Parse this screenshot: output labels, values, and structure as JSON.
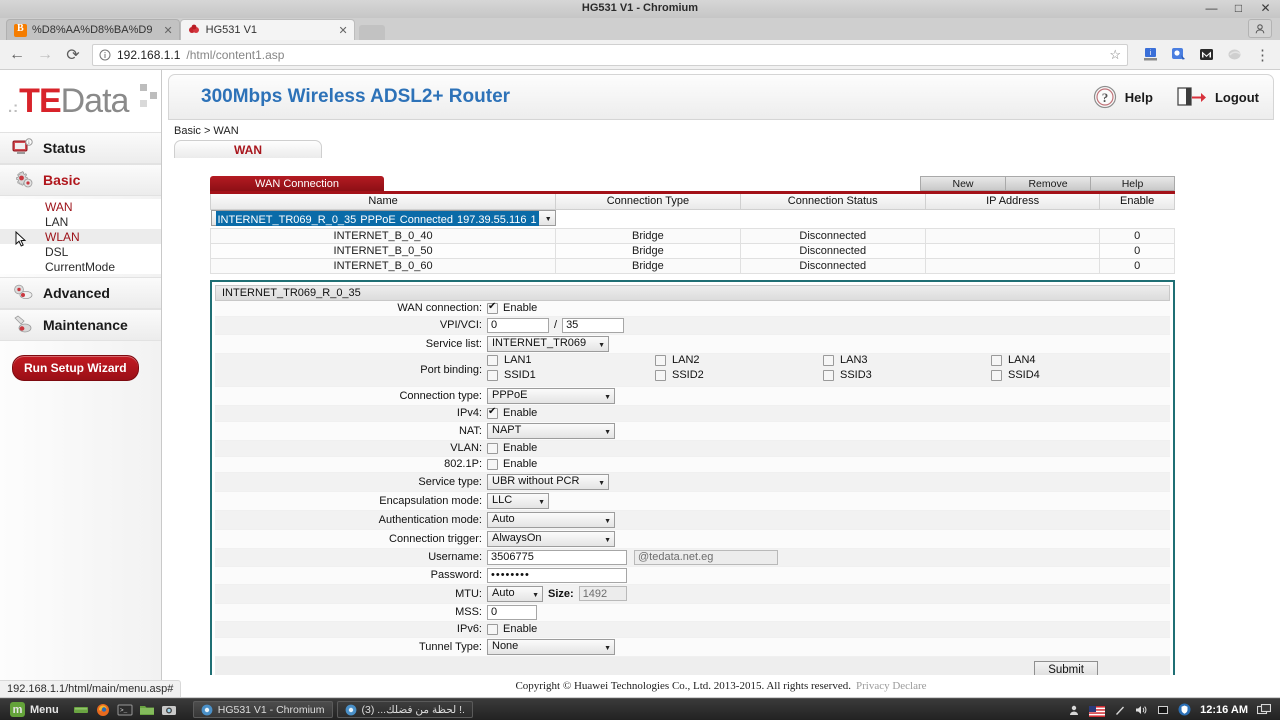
{
  "browser": {
    "window_title": "HG531 V1 - Chromium",
    "minimize": "—",
    "maximize": "□",
    "close": "✕",
    "tabs": [
      {
        "title": "%D8%AA%D8%BA%D9",
        "favicon": "blogger-icon",
        "active": false,
        "close": "✕"
      },
      {
        "title": "HG531 V1",
        "favicon": "router-icon",
        "active": true,
        "close": "✕"
      }
    ],
    "nav": {
      "back": "←",
      "forward": "→",
      "reload": "⟳"
    },
    "address": {
      "security_icon": "info-circle-icon",
      "host": "192.168.1.1",
      "path": "/html/content1.asp",
      "star": "☆"
    },
    "extensions": [
      "extension-icon-1",
      "extension-icon-2",
      "gmail-icon",
      "extension-icon-4"
    ],
    "menu": "⋮"
  },
  "sidebar": {
    "logo": {
      "te": "TE",
      "data": "Data"
    },
    "groups": [
      {
        "label": "Status",
        "icon": "status-monitor-icon",
        "active": false
      },
      {
        "label": "Basic",
        "icon": "gear-icon",
        "active": true
      },
      {
        "label": "Advanced",
        "icon": "advanced-gears-icon",
        "active": false
      },
      {
        "label": "Maintenance",
        "icon": "wrench-icon",
        "active": false
      }
    ],
    "basic_items": [
      {
        "label": "WAN",
        "selected": true,
        "hover": false
      },
      {
        "label": "LAN",
        "selected": false,
        "hover": false
      },
      {
        "label": "WLAN",
        "selected": true,
        "hover": true
      },
      {
        "label": "DSL",
        "selected": false,
        "hover": false
      },
      {
        "label": "CurrentMode",
        "selected": false,
        "hover": false
      }
    ],
    "wizard_button": "Run Setup Wizard"
  },
  "header": {
    "title": "300Mbps Wireless ADSL2+ Router",
    "help": "Help",
    "help_icon": "question-mark-icon",
    "logout": "Logout",
    "logout_icon": "logout-door-icon",
    "breadcrumb": "Basic > WAN",
    "page_tab": "WAN"
  },
  "wan_table": {
    "section_title": "WAN Connection",
    "buttons": {
      "new": "New",
      "remove": "Remove",
      "help": "Help"
    },
    "columns": [
      "Name",
      "Connection Type",
      "Connection Status",
      "IP Address",
      "Enable"
    ],
    "rows": [
      {
        "name": "INTERNET_TR069_R_0_35",
        "type": "PPPoE",
        "status": "Connected",
        "ip": "197.39.55.116",
        "enable": "1",
        "selected": true
      },
      {
        "name": "INTERNET_B_0_40",
        "type": "Bridge",
        "status": "Disconnected",
        "ip": "",
        "enable": "0",
        "selected": false
      },
      {
        "name": "INTERNET_B_0_50",
        "type": "Bridge",
        "status": "Disconnected",
        "ip": "",
        "enable": "0",
        "selected": false
      },
      {
        "name": "INTERNET_B_0_60",
        "type": "Bridge",
        "status": "Disconnected",
        "ip": "",
        "enable": "0",
        "selected": false
      }
    ]
  },
  "form": {
    "title": "INTERNET_TR069_R_0_35",
    "wan_connection": {
      "label": "WAN connection:",
      "checkbox_label": "Enable",
      "checked": true
    },
    "vpi_vci": {
      "label": "VPI/VCI:",
      "vpi": "0",
      "separator": "/",
      "vci": "35"
    },
    "service_list": {
      "label": "Service list:",
      "value": "INTERNET_TR069"
    },
    "port_binding": {
      "label": "Port binding:",
      "items": [
        {
          "label": "LAN1",
          "checked": false
        },
        {
          "label": "LAN2",
          "checked": false
        },
        {
          "label": "LAN3",
          "checked": false
        },
        {
          "label": "LAN4",
          "checked": false
        },
        {
          "label": "SSID1",
          "checked": false
        },
        {
          "label": "SSID2",
          "checked": false
        },
        {
          "label": "SSID3",
          "checked": false
        },
        {
          "label": "SSID4",
          "checked": false
        }
      ]
    },
    "connection_type": {
      "label": "Connection type:",
      "value": "PPPoE"
    },
    "ipv4": {
      "label": "IPv4:",
      "checkbox_label": "Enable",
      "checked": true
    },
    "nat": {
      "label": "NAT:",
      "value": "NAPT"
    },
    "vlan": {
      "label": "VLAN:",
      "checkbox_label": "Enable",
      "checked": false
    },
    "dot1p": {
      "label": "802.1P:",
      "checkbox_label": "Enable",
      "checked": false
    },
    "service_type": {
      "label": "Service type:",
      "value": "UBR without PCR"
    },
    "encapsulation_mode": {
      "label": "Encapsulation mode:",
      "value": "LLC"
    },
    "authentication_mode": {
      "label": "Authentication mode:",
      "value": "Auto"
    },
    "connection_trigger": {
      "label": "Connection trigger:",
      "value": "AlwaysOn"
    },
    "username": {
      "label": "Username:",
      "value": "3506775",
      "suffix": "@tedata.net.eg"
    },
    "password": {
      "label": "Password:",
      "value": "••••••••"
    },
    "mtu": {
      "label": "MTU:",
      "value": "Auto",
      "size_label": "Size:",
      "size_value": "1492"
    },
    "mss": {
      "label": "MSS:",
      "value": "0"
    },
    "ipv6": {
      "label": "IPv6:",
      "checkbox_label": "Enable",
      "checked": false
    },
    "tunnel_type": {
      "label": "Tunnel Type:",
      "value": "None"
    },
    "submit": "Submit"
  },
  "footer": {
    "copyright": "Copyright © Huawei Technologies Co., Ltd. 2013-2015. All rights reserved.",
    "privacy": "Privacy Declare",
    "status_link": "192.168.1.1/html/main/menu.asp#"
  },
  "taskbar": {
    "menu": "Menu",
    "quick_launch": [
      "show-desktop-icon",
      "firefox-icon",
      "terminal-icon",
      "files-icon",
      "screenshot-icon"
    ],
    "windows": [
      {
        "title": "HG531 V1 - Chromium",
        "icon": "chromium-icon",
        "active": true
      },
      {
        "title": "(3) ...لحظة من فضلك !.",
        "icon": "chromium-icon",
        "active": false
      }
    ],
    "tray": [
      "user-icon",
      "us-flag-icon",
      "brightness-icon",
      "volume-icon",
      "display-icon",
      "shield-icon"
    ],
    "clock": "12:16 AM",
    "tray_last": "window-icon"
  },
  "colors": {
    "brand_red": "#b0161c",
    "title_blue": "#2d72b8",
    "row_selected": "#0a6ba8",
    "panel_border": "#1f6f74"
  }
}
